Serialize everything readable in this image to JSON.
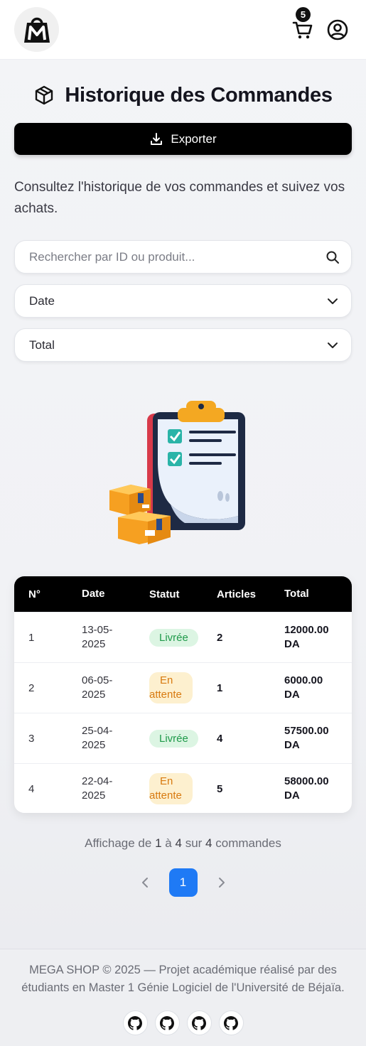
{
  "header": {
    "logo_icon": "mega-shop-bag-logo",
    "cart_count": "5",
    "cart_icon": "cart-icon",
    "user_icon": "user-circle-icon"
  },
  "page": {
    "title": "Historique des Commandes",
    "title_icon": "package-icon",
    "export_label": "Exporter",
    "intro": "Consultez l'historique de vos commandes et suivez vos achats."
  },
  "filters": {
    "search_placeholder": "Rechercher par ID ou produit...",
    "date_label": "Date",
    "total_label": "Total"
  },
  "table": {
    "headers": [
      "N°",
      "Date",
      "Statut",
      "Articles",
      "Total"
    ],
    "rows": [
      {
        "id": "1",
        "date_line1": "13-05-",
        "date_line2": "2025",
        "status": "Livrée",
        "status_type": "delivered",
        "items": "2",
        "total_line1": "12000.00",
        "total_line2": "DA"
      },
      {
        "id": "2",
        "date_line1": "06-05-",
        "date_line2": "2025",
        "status_line1": "En",
        "status_line2": "attente",
        "status_type": "pending",
        "items": "1",
        "total_line1": "6000.00",
        "total_line2": "DA"
      },
      {
        "id": "3",
        "date_line1": "25-04-",
        "date_line2": "2025",
        "status": "Livrée",
        "status_type": "delivered",
        "items": "4",
        "total_line1": "57500.00",
        "total_line2": "DA"
      },
      {
        "id": "4",
        "date_line1": "22-04-",
        "date_line2": "2025",
        "status_line1": "En",
        "status_line2": "attente",
        "status_type": "pending",
        "items": "5",
        "total_line1": "58000.00",
        "total_line2": "DA"
      }
    ]
  },
  "summary": {
    "prefix": "Affichage de",
    "from": "1",
    "to_word": "à",
    "to": "4",
    "of_word": "sur",
    "count": "4",
    "suffix": "commandes"
  },
  "pagination": {
    "current": "1"
  },
  "footer": {
    "text": "MEGA SHOP © 2025 — Projet académique réalisé par des étudiants en Master 1 Génie Logiciel de l'Université de Béjaïa.",
    "links": [
      "github-icon",
      "github-icon",
      "github-icon",
      "github-icon"
    ]
  },
  "colors": {
    "accent": "#1f7af5",
    "delivered_bg": "#dcf5e3",
    "delivered_fg": "#1f9a4a",
    "pending_bg": "#fdf0cf",
    "pending_fg": "#d87a10"
  }
}
